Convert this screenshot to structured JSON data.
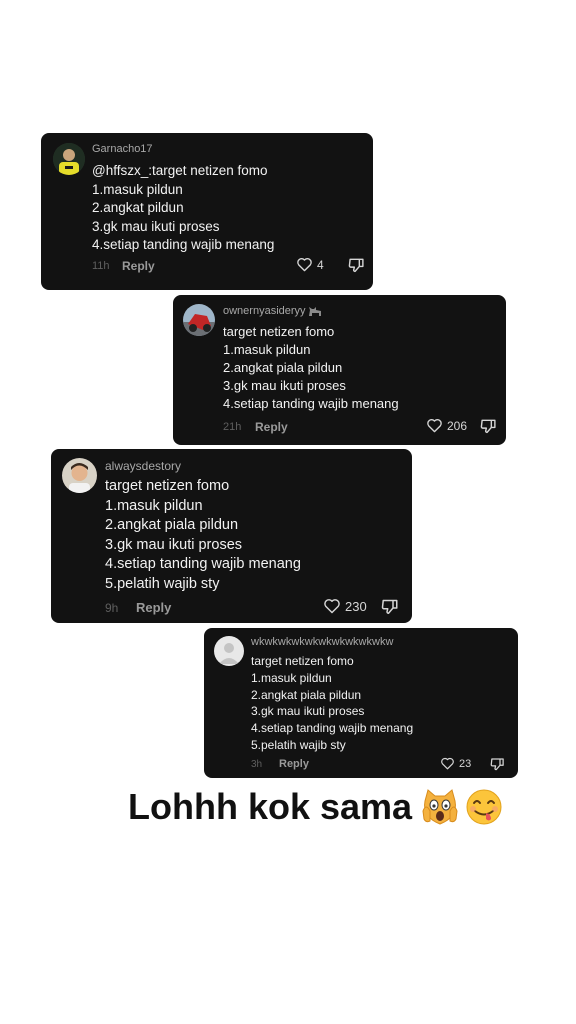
{
  "comments": [
    {
      "username": "Garnacho17",
      "lines": [
        "@hffszx_:target netizen fomo",
        "1.masuk pildun",
        "2.angkat pildun",
        "3.gk mau ikuti proses",
        "4.setiap tanding wajib menang"
      ],
      "time": "11h",
      "reply_label": "Reply",
      "likes": "4"
    },
    {
      "username": "ownernyasideryy",
      "lines": [
        "target netizen fomo",
        "1.masuk pildun",
        "2.angkat piala pildun",
        "3.gk mau ikuti proses",
        "4.setiap tanding wajib menang"
      ],
      "time": "21h",
      "reply_label": "Reply",
      "likes": "206"
    },
    {
      "username": "alwaysdestory",
      "lines": [
        "target netizen fomo",
        "1.masuk pildun",
        "2.angkat piala pildun",
        "3.gk mau ikuti proses",
        "4.setiap tanding wajib menang",
        "5.pelatih wajib sty"
      ],
      "time": "9h",
      "reply_label": "Reply",
      "likes": "230"
    },
    {
      "username": "wkwkwkwkwkwkwkwkwkwkw",
      "lines": [
        "target netizen fomo",
        "1.masuk pildun",
        "2.angkat piala pildun",
        "3.gk mau ikuti proses",
        "4.setiap tanding wajib menang",
        "5.pelatih wajib sty"
      ],
      "time": "3h",
      "reply_label": "Reply",
      "likes": "23"
    }
  ],
  "caption": "Lohhh kok sama",
  "caption_emojis": [
    "screaming-cat-emoji",
    "yum-face-emoji"
  ]
}
